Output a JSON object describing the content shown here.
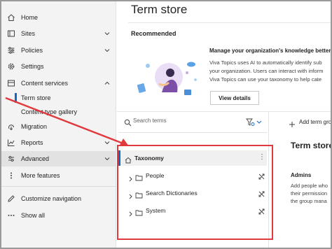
{
  "nav": {
    "items": [
      {
        "label": "Home",
        "icon": "home-icon"
      },
      {
        "label": "Sites",
        "icon": "sites-icon"
      },
      {
        "label": "Policies",
        "icon": "policies-icon"
      },
      {
        "label": "Settings",
        "icon": "settings-icon"
      },
      {
        "label": "Content services",
        "icon": "content-services-icon"
      },
      {
        "label": "Term store"
      },
      {
        "label": "Content type gallery"
      },
      {
        "label": "Migration",
        "icon": "migration-icon"
      },
      {
        "label": "Reports",
        "icon": "reports-icon"
      },
      {
        "label": "Advanced",
        "icon": "advanced-icon"
      },
      {
        "label": "More features",
        "icon": "more-features-icon"
      },
      {
        "label": "Customize navigation",
        "icon": "pencil-icon"
      },
      {
        "label": "Show all",
        "icon": "ellipsis-icon"
      }
    ]
  },
  "page": {
    "title": "Term store"
  },
  "recommended": {
    "heading": "Recommended",
    "title": "Manage your organization's knowledge better",
    "lines": [
      "Viva Topics uses AI to automatically identify sub",
      "your organization. Users can interact with inform",
      "Viva Topics can use your taxonomy to help cate"
    ],
    "button": "View details"
  },
  "search": {
    "placeholder": "Search terms"
  },
  "tree": {
    "root": "Taxonomy",
    "groups": [
      "People",
      "Search Dictionaries",
      "System"
    ]
  },
  "right_panel": {
    "add_term_group": "Add term gro",
    "title": "Term store",
    "admins_label": "Admins",
    "admins_lines": [
      "Add people who",
      "their permission",
      "the group mana"
    ]
  },
  "colors": {
    "accent": "#0f6cbd",
    "callout": "#e0393e"
  }
}
